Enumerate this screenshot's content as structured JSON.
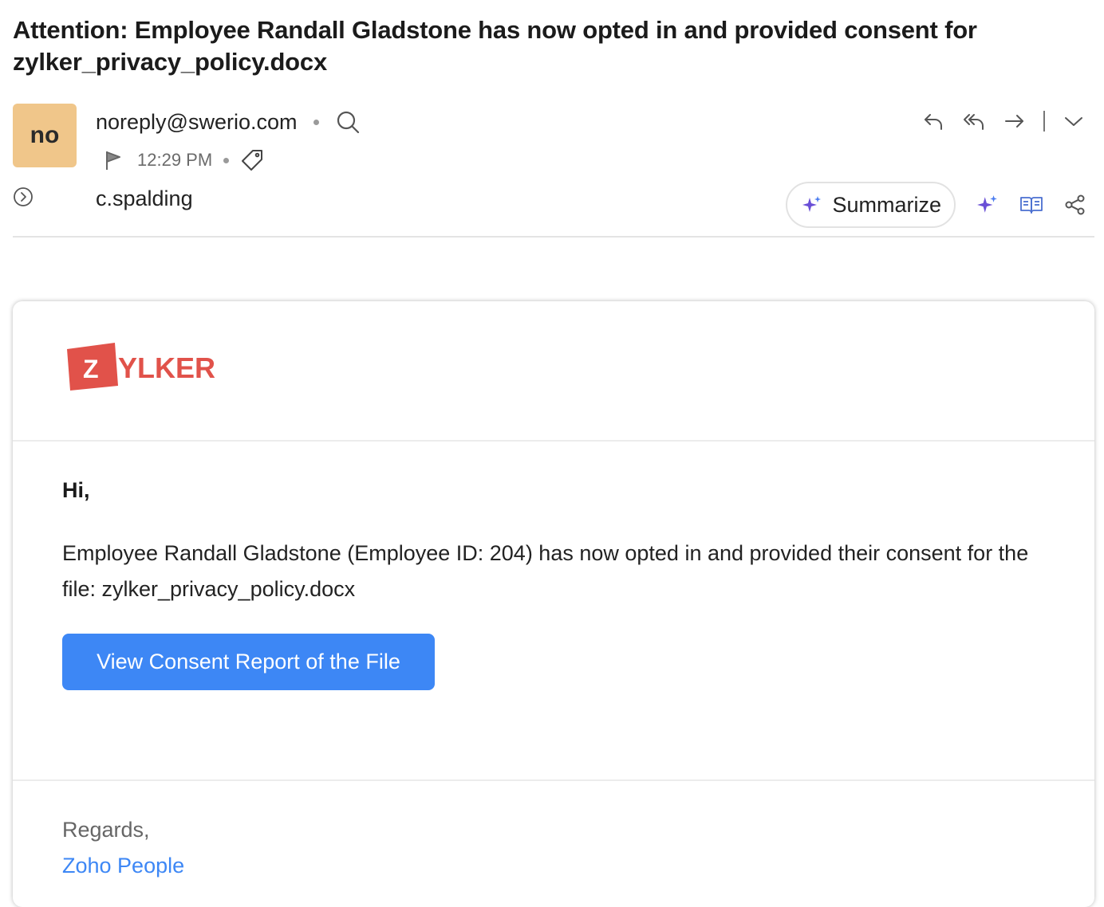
{
  "email": {
    "subject": "Attention: Employee Randall Gladstone has now opted in and provided consent for zylker_privacy_policy.docx",
    "avatar_text": "no",
    "sender": "noreply@swerio.com",
    "time": "12:29 PM",
    "recipient": "c.spalding"
  },
  "toolbar": {
    "actions": [
      "reply-icon",
      "reply-all-icon",
      "forward-icon",
      "chevron-down-icon"
    ],
    "summarize_label": "Summarize",
    "tools": [
      "ai-sparkle-icon",
      "reading-mode-icon",
      "share-icon"
    ]
  },
  "body": {
    "logo": {
      "badge_letter": "Z",
      "wordmark": "YLKER"
    },
    "greeting": "Hi,",
    "message": "Employee Randall Gladstone (Employee ID: 204) has now opted in and provided their consent for the file: zylker_privacy_policy.docx",
    "cta_label": "View Consent Report of the File",
    "regards": "Regards,",
    "signature": "Zoho People"
  },
  "colors": {
    "avatar_bg": "#f0c68a",
    "cta_bg": "#3d87f5",
    "link": "#3d87f5",
    "logo_red": "#e1524a",
    "ai_accent": "#6a4fd6"
  }
}
